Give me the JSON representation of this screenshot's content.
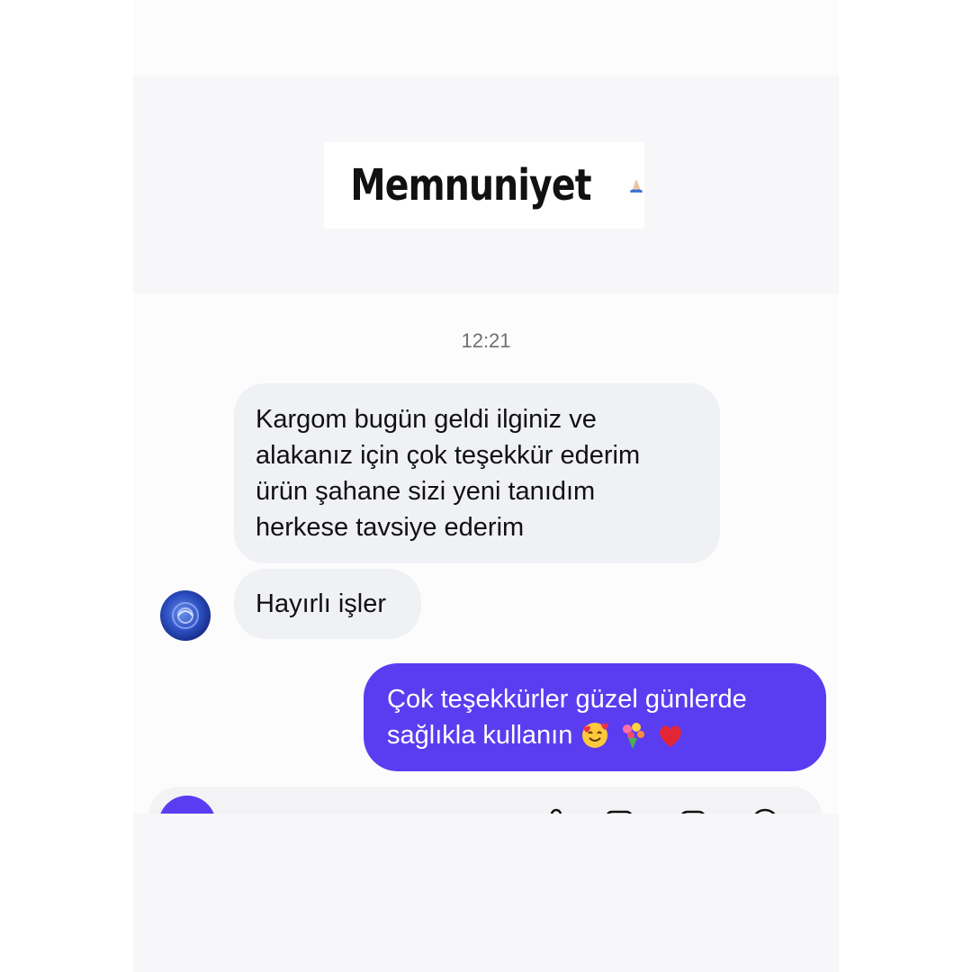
{
  "header": {
    "title": "Memnuniyet",
    "title_icon": "folded-hands-icon"
  },
  "chat": {
    "timestamp": "12:21",
    "incoming": {
      "bubble1_lines": [
        "Kargom bugün geldi ilginiz ve",
        "alakanız için çok teşekkür ederim",
        "ürün şahane sizi yeni tanıdım",
        "herkese tavsiye ederim"
      ],
      "bubble2": "Hayırlı işler",
      "avatar_icon": "blue-rose-avatar"
    },
    "outgoing": {
      "line1": "Çok teşekkürler güzel günlerde",
      "line2": "sağlıkla kullanın",
      "emojis": [
        "smiling-face-with-hearts-icon",
        "bouquet-icon",
        "red-heart-icon"
      ]
    }
  },
  "composer": {
    "icons": [
      "camera-icon",
      "microphone-icon",
      "gallery-icon",
      "sticker-icon",
      "plus-icon"
    ]
  },
  "colors": {
    "outgoing_bubble": "#5a3df0",
    "incoming_bubble": "#f0f1f4",
    "timestamp": "#6f6f74"
  }
}
